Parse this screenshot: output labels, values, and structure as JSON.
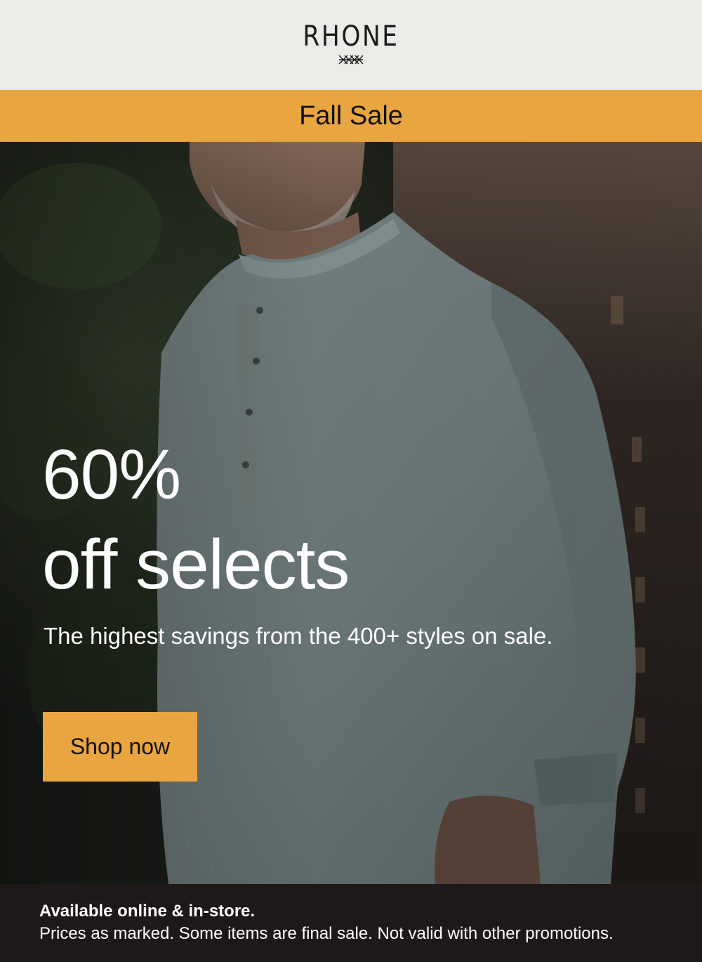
{
  "header": {
    "brand": "RHONE"
  },
  "banner": {
    "title": "Fall Sale"
  },
  "hero": {
    "headline_line1": "60%",
    "headline_line2": "off selects",
    "subheadline": "The highest savings from the 400+ styles on sale.",
    "cta_label": "Shop now",
    "image": "model-wearing-grey-henley-photo"
  },
  "footer": {
    "availability": "Available online & in-store.",
    "disclaimer": "Prices as marked. Some items are final sale. Not valid with other promotions."
  },
  "colors": {
    "accent": "#e9a53f",
    "header_bg": "#ecebe7",
    "footer_bg": "#1e1819",
    "text_dark": "#1d1b1c",
    "text_light": "#ffffff"
  },
  "icons": {
    "logo_mark": "crossed-stitch-icon"
  }
}
